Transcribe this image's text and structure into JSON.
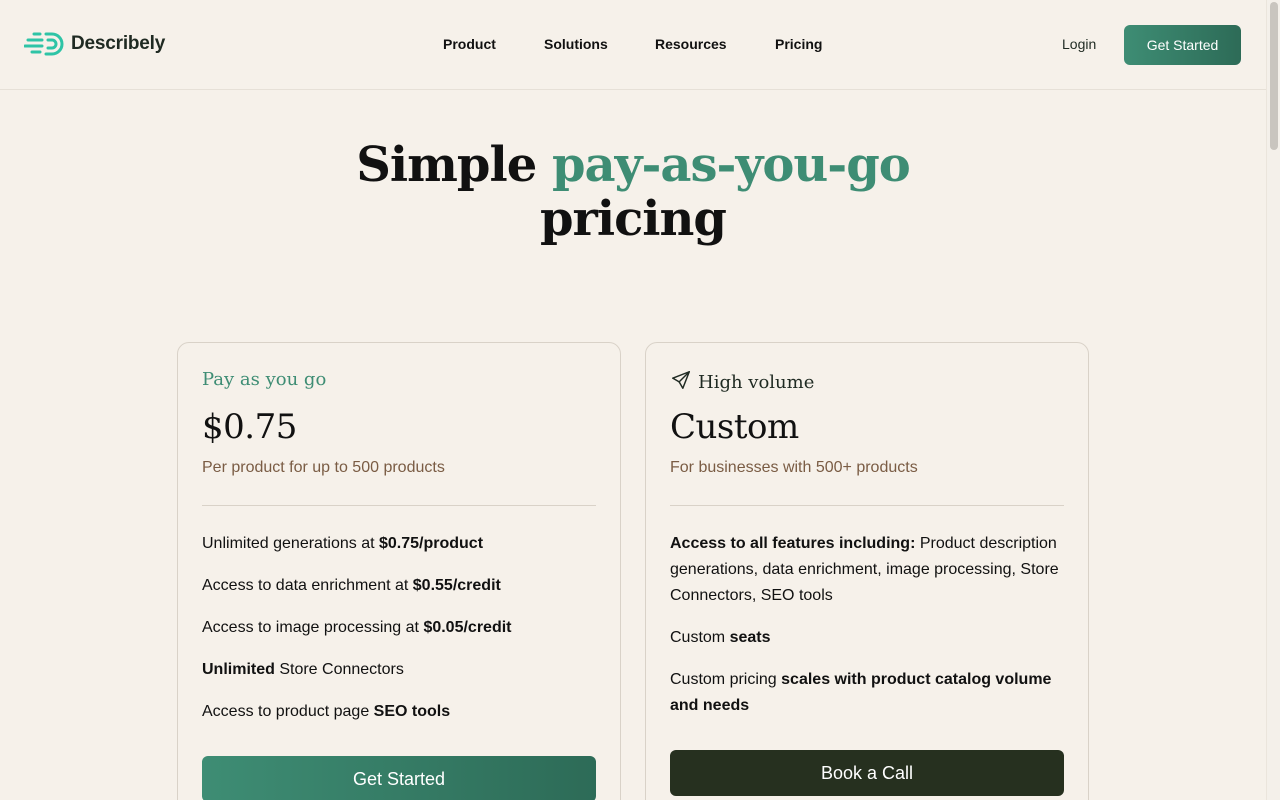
{
  "brand": {
    "name": "Describely"
  },
  "nav": {
    "items": [
      "Product",
      "Solutions",
      "Resources",
      "Pricing"
    ]
  },
  "header": {
    "login_label": "Login",
    "cta_label": "Get Started"
  },
  "hero": {
    "title_start": "Simple ",
    "title_accent": "pay-as-you-go",
    "title_end": "pricing"
  },
  "plans": [
    {
      "eyebrow": "Pay as you go",
      "price": "$0.75",
      "subtitle": "Per product for up to 500 products",
      "features": [
        {
          "pre": "Unlimited generations at ",
          "bold": "$0.75/product",
          "post": ""
        },
        {
          "pre": "Access to data enrichment at ",
          "bold": "$0.55/credit",
          "post": ""
        },
        {
          "pre": "Access to image processing at ",
          "bold": "$0.05/credit",
          "post": ""
        },
        {
          "pre": "",
          "bold": "Unlimited",
          "post": " Store Connectors"
        },
        {
          "pre": "Access to product page ",
          "bold": "SEO tools",
          "post": ""
        }
      ],
      "cta_label": "Get Started"
    },
    {
      "eyebrow": "High volume",
      "eyebrow_icon": "rocket-icon",
      "price": "Custom",
      "subtitle": "For businesses with 500+ products",
      "features": [
        {
          "pre": "",
          "bold": "Access to all features including:",
          "post": " Product description generations, data enrichment, image processing, Store Connectors, SEO tools"
        },
        {
          "pre": "Custom ",
          "bold": "seats",
          "post": ""
        },
        {
          "pre": "Custom pricing ",
          "bold": "scales with product catalog volume and needs",
          "post": ""
        }
      ],
      "cta_label": "Book a Call"
    }
  ],
  "colors": {
    "accent": "#3e8d74",
    "dark_button": "#26301f",
    "background": "#f6f1ea",
    "subtitle": "#7a5c44"
  }
}
